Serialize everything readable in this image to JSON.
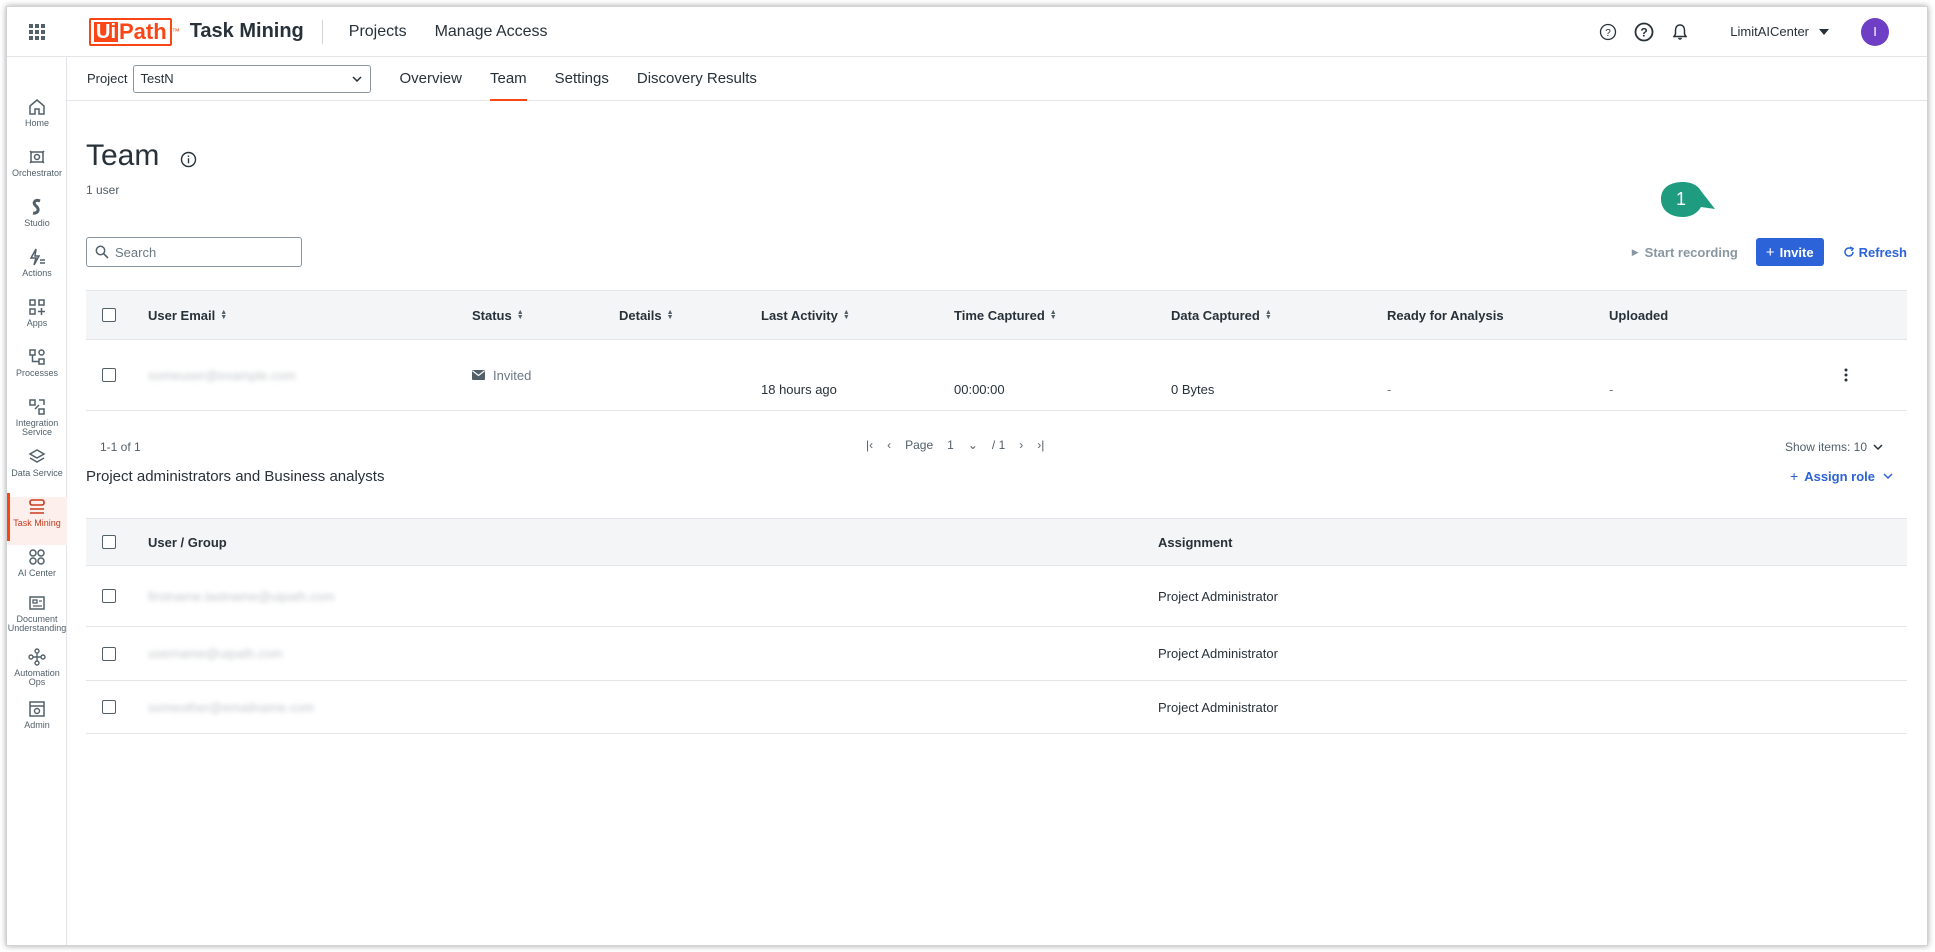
{
  "topbar": {
    "brand_ui": "Ui",
    "brand_path": "Path",
    "brand_tm": "™",
    "product": "Task Mining",
    "nav": [
      "Projects",
      "Manage Access"
    ],
    "tenant": "LimitAICenter",
    "avatar_initial": "I"
  },
  "sidebar": {
    "items": [
      {
        "label": "Home",
        "icon": "home-icon"
      },
      {
        "label": "Orchestrator",
        "icon": "orchestrator-icon"
      },
      {
        "label": "Studio",
        "icon": "studio-icon"
      },
      {
        "label": "Actions",
        "icon": "actions-icon"
      },
      {
        "label": "Apps",
        "icon": "apps-icon"
      },
      {
        "label": "Processes",
        "icon": "processes-icon"
      },
      {
        "label": "Integration Service",
        "icon": "integration-icon"
      },
      {
        "label": "Data Service",
        "icon": "data-service-icon"
      },
      {
        "label": "Task Mining",
        "icon": "task-mining-icon",
        "active": true
      },
      {
        "label": "AI Center",
        "icon": "ai-center-icon"
      },
      {
        "label": "Document Understanding",
        "icon": "document-icon"
      },
      {
        "label": "Automation Ops",
        "icon": "automation-ops-icon"
      },
      {
        "label": "Admin",
        "icon": "admin-icon"
      }
    ]
  },
  "subbar": {
    "project_label": "Project",
    "project_value": "TestN",
    "tabs": [
      "Overview",
      "Team",
      "Settings",
      "Discovery Results"
    ],
    "active_tab": "Team"
  },
  "page": {
    "title": "Team",
    "user_count": "1 user",
    "search_placeholder": "Search",
    "start_recording": "Start recording",
    "invite": "Invite",
    "refresh": "Refresh",
    "callout_number": "1"
  },
  "team_table": {
    "columns": [
      "User Email",
      "Status",
      "Details",
      "Last Activity",
      "Time Captured",
      "Data Captured",
      "Ready for Analysis",
      "Uploaded"
    ],
    "rows": [
      {
        "email": "someuser@example.com",
        "status": "Invited",
        "details": "",
        "last_activity": "18 hours ago",
        "time_captured": "00:00:00",
        "data_captured": "0 Bytes",
        "ready": "-",
        "uploaded": "-"
      }
    ]
  },
  "pager": {
    "range": "1-1 of 1",
    "page_label": "Page",
    "page_value": "1",
    "page_total": "/ 1",
    "show_items": "Show items: 10"
  },
  "admins": {
    "title": "Project administrators and Business analysts",
    "assign_role": "Assign role",
    "columns": [
      "User / Group",
      "Assignment"
    ],
    "rows": [
      {
        "user": "firstname.lastname@uipath.com",
        "assignment": "Project Administrator"
      },
      {
        "user": "username@uipath.com",
        "assignment": "Project Administrator"
      },
      {
        "user": "someother@emailname.com",
        "assignment": "Project Administrator"
      }
    ]
  },
  "colors": {
    "accent": "#fa4616",
    "primary": "#2c63d8",
    "callout": "#1f9b80",
    "avatar": "#6e3ec4"
  }
}
